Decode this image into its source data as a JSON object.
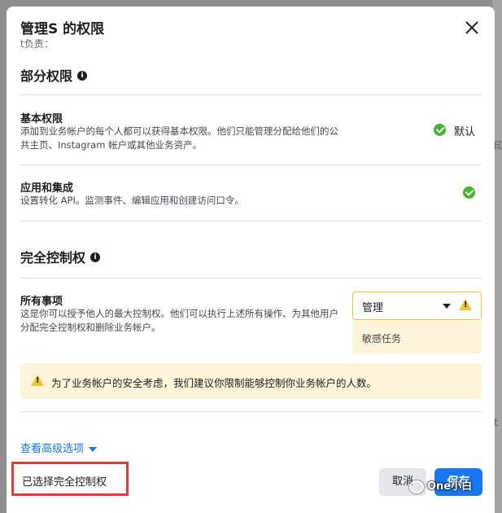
{
  "dialog": {
    "title": "管理S         的权限",
    "subtitle": "              t负责："
  },
  "partial": {
    "heading": "部分权限",
    "items": [
      {
        "title": "基本权限",
        "desc": "添加到业务帐户的每个人都可以获得基本权限。他们只能管理分配给他们的公共主页、Instagram 帐户或其他业务资产。",
        "status": "默认"
      },
      {
        "title": "应用和集成",
        "desc": "设置转化 API。监测事件、编辑应用和创建访问口令。"
      }
    ]
  },
  "full": {
    "heading": "完全控制权",
    "item": {
      "title": "所有事项",
      "desc": "这是你可以授予他人的最大控制权。他们可以执行上述所有操作、为其他用户分配完全控制权和删除业务帐户。"
    },
    "select_value": "管理",
    "sensitive_label": "敏感任务",
    "warning": "为了业务帐户的安全考虑，我们建议你限制能够控制你业务帐户的人数。"
  },
  "advanced_link": "查看高级选项",
  "footer": {
    "status": "已选择完全控制权",
    "cancel": "取消",
    "save": "保存"
  },
  "watermark": "One小白",
  "background_fragments": [
    "印",
    "t"
  ],
  "colors": {
    "accent": "#1877f2",
    "success": "#42b72a",
    "warning": "#f2c230",
    "warning_bg": "#fdf4d9",
    "highlight_border": "#e53935"
  }
}
